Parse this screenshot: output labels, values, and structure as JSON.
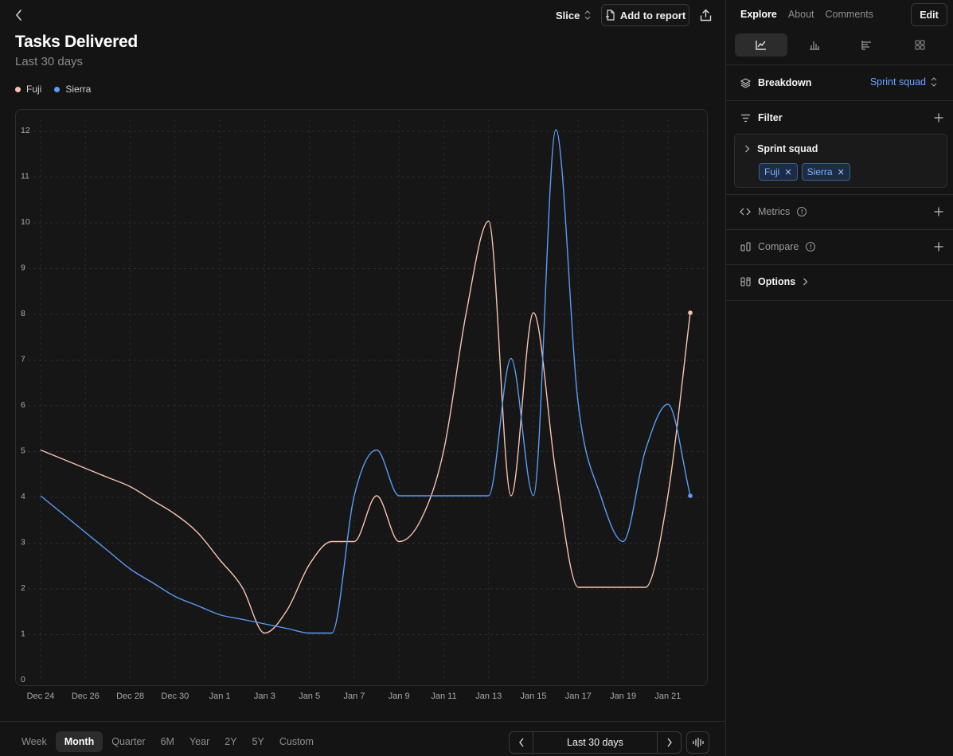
{
  "header": {
    "slice_label": "Slice",
    "add_to_report_label": "Add to report"
  },
  "report": {
    "title": "Tasks Delivered",
    "subtitle": "Last 30 days"
  },
  "legend": [
    {
      "name": "Fuji",
      "color": "#f7c3b0"
    },
    {
      "name": "Sierra",
      "color": "#5b9cf5"
    }
  ],
  "chart_data": {
    "type": "line",
    "title": "Tasks Delivered",
    "subtitle": "Last 30 days",
    "x": [
      "Dec 24",
      "Dec 25",
      "Dec 26",
      "Dec 27",
      "Dec 28",
      "Dec 29",
      "Dec 30",
      "Dec 31",
      "Jan 1",
      "Jan 2",
      "Jan 3",
      "Jan 4",
      "Jan 5",
      "Jan 6",
      "Jan 7",
      "Jan 8",
      "Jan 9",
      "Jan 10",
      "Jan 11",
      "Jan 12",
      "Jan 13",
      "Jan 14",
      "Jan 15",
      "Jan 16",
      "Jan 17",
      "Jan 18",
      "Jan 19",
      "Jan 20",
      "Jan 21",
      "Jan 22"
    ],
    "x_tick_labels": [
      "Dec 24",
      "Dec 26",
      "Dec 28",
      "Dec 30",
      "Jan 1",
      "Jan 3",
      "Jan 5",
      "Jan 7",
      "Jan 9",
      "Jan 11",
      "Jan 13",
      "Jan 15",
      "Jan 17",
      "Jan 19",
      "Jan 21"
    ],
    "y_tick_labels": [
      "0",
      "1",
      "2",
      "3",
      "4",
      "5",
      "6",
      "7",
      "8",
      "9",
      "10",
      "11",
      "12"
    ],
    "ylim": [
      0,
      12
    ],
    "grid": true,
    "series": [
      {
        "name": "Fuji",
        "color": "#f7c3b0",
        "values": [
          5,
          4.8,
          4.6,
          4.4,
          4.2,
          3.9,
          3.6,
          3.2,
          2.6,
          2,
          1,
          1.5,
          2.5,
          3,
          3,
          4,
          3,
          3.5,
          5,
          8,
          10,
          4,
          8,
          4.5,
          2,
          2,
          2,
          2,
          4,
          8
        ]
      },
      {
        "name": "Sierra",
        "color": "#5b9cf5",
        "values": [
          4,
          3.6,
          3.2,
          2.8,
          2.4,
          2.1,
          1.8,
          1.6,
          1.4,
          1.3,
          1.2,
          1.1,
          1,
          1,
          4,
          5,
          4,
          4,
          4,
          4,
          4,
          7,
          4,
          12,
          6,
          4,
          3,
          5,
          6,
          4
        ]
      }
    ]
  },
  "bottom": {
    "ranges": [
      "Week",
      "Month",
      "Quarter",
      "6M",
      "Year",
      "2Y",
      "5Y",
      "Custom"
    ],
    "active_range": "Month",
    "period_label": "Last 30 days"
  },
  "sidebar": {
    "tabs": [
      "Explore",
      "About",
      "Comments"
    ],
    "active_tab": "Explore",
    "edit_label": "Edit",
    "breakdown": {
      "label": "Breakdown",
      "value": "Sprint squad"
    },
    "filter": {
      "label": "Filter",
      "group_label": "Sprint squad",
      "chips": [
        "Fuji",
        "Sierra"
      ]
    },
    "metrics_label": "Metrics",
    "compare_label": "Compare",
    "options_label": "Options"
  }
}
